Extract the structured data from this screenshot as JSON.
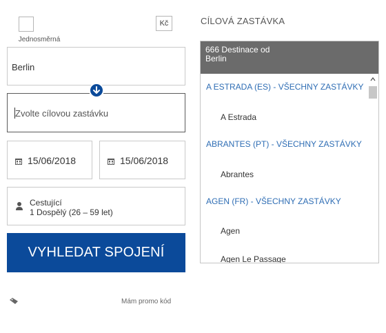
{
  "form": {
    "one_way_label": "Jednosměrná",
    "currency_label": "Kč",
    "from_value": "Berlin",
    "to_placeholder": "Zvolte cílovou zastávku",
    "depart_date": "15/06/2018",
    "return_date": "15/06/2018",
    "passengers_title": "Cestující",
    "passengers_value": "1 Dospělý (26 – 59 let)",
    "search_label": "VYHLEDAT SPOJENÍ",
    "promo_label": "Mám promo kód"
  },
  "destinations": {
    "heading": "CÍLOVÁ ZASTÁVKA",
    "header_line1": "666 Destinace od",
    "header_line2": "Berlin",
    "items": [
      {
        "type": "group",
        "label": "A ESTRADA (ES) - VŠECHNY ZASTÁVKY"
      },
      {
        "type": "stop",
        "label": "A Estrada"
      },
      {
        "type": "group",
        "label": "ABRANTES (PT) - VŠECHNY ZASTÁVKY"
      },
      {
        "type": "stop",
        "label": "Abrantes"
      },
      {
        "type": "group",
        "label": "AGEN (FR) - VŠECHNY ZASTÁVKY"
      },
      {
        "type": "stop",
        "label": "Agen"
      },
      {
        "type": "stop",
        "label": "Agen Le Passage"
      }
    ]
  },
  "colors": {
    "brand_blue": "#0b4a9a",
    "link_blue": "#2e6db4",
    "panel_header": "#6b6b6b"
  },
  "icons": {
    "swap": "arrow-down-icon",
    "calendar": "calendar-icon",
    "passenger": "person-icon",
    "promo": "tag-icon",
    "scroll_up": "chevron-up-icon"
  }
}
